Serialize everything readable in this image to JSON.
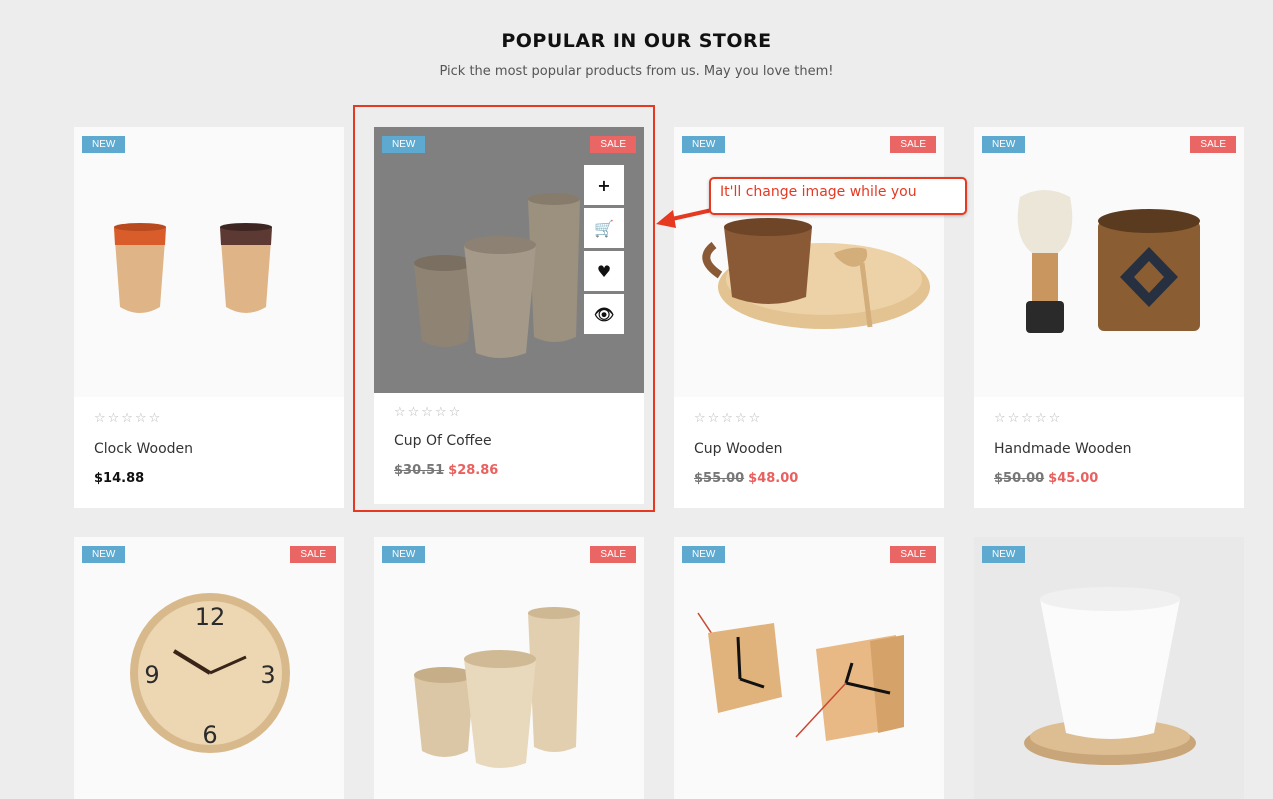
{
  "section": {
    "title": "POPULAR IN OUR STORE",
    "subtitle": "Pick the most popular products from us. May you love them!"
  },
  "badges": {
    "new": "NEW",
    "sale": "SALE"
  },
  "stars": "☆☆☆☆☆",
  "hover_actions": [
    {
      "name": "add-icon",
      "glyph": "+"
    },
    {
      "name": "cart-icon",
      "glyph": "🛒"
    },
    {
      "name": "heart-icon",
      "glyph": "♥"
    },
    {
      "name": "eye-icon",
      "glyph": "👁"
    }
  ],
  "products": [
    {
      "name": "Clock Wooden",
      "price": "$14.88"
    },
    {
      "name": "Cup Of Coffee",
      "old_price": "$30.51",
      "sale_price": "$28.86"
    },
    {
      "name": "Cup Wooden",
      "old_price": "$55.00",
      "sale_price": "$48.00"
    },
    {
      "name": "Handmade Wooden",
      "old_price": "$50.00",
      "sale_price": "$45.00"
    }
  ],
  "annotation": {
    "callout_text": "It'll change image while you"
  },
  "colors": {
    "new_badge": "#5ea9cf",
    "sale_badge": "#ea6665",
    "sale_price": "#e8615f",
    "annotation": "#e53922"
  }
}
